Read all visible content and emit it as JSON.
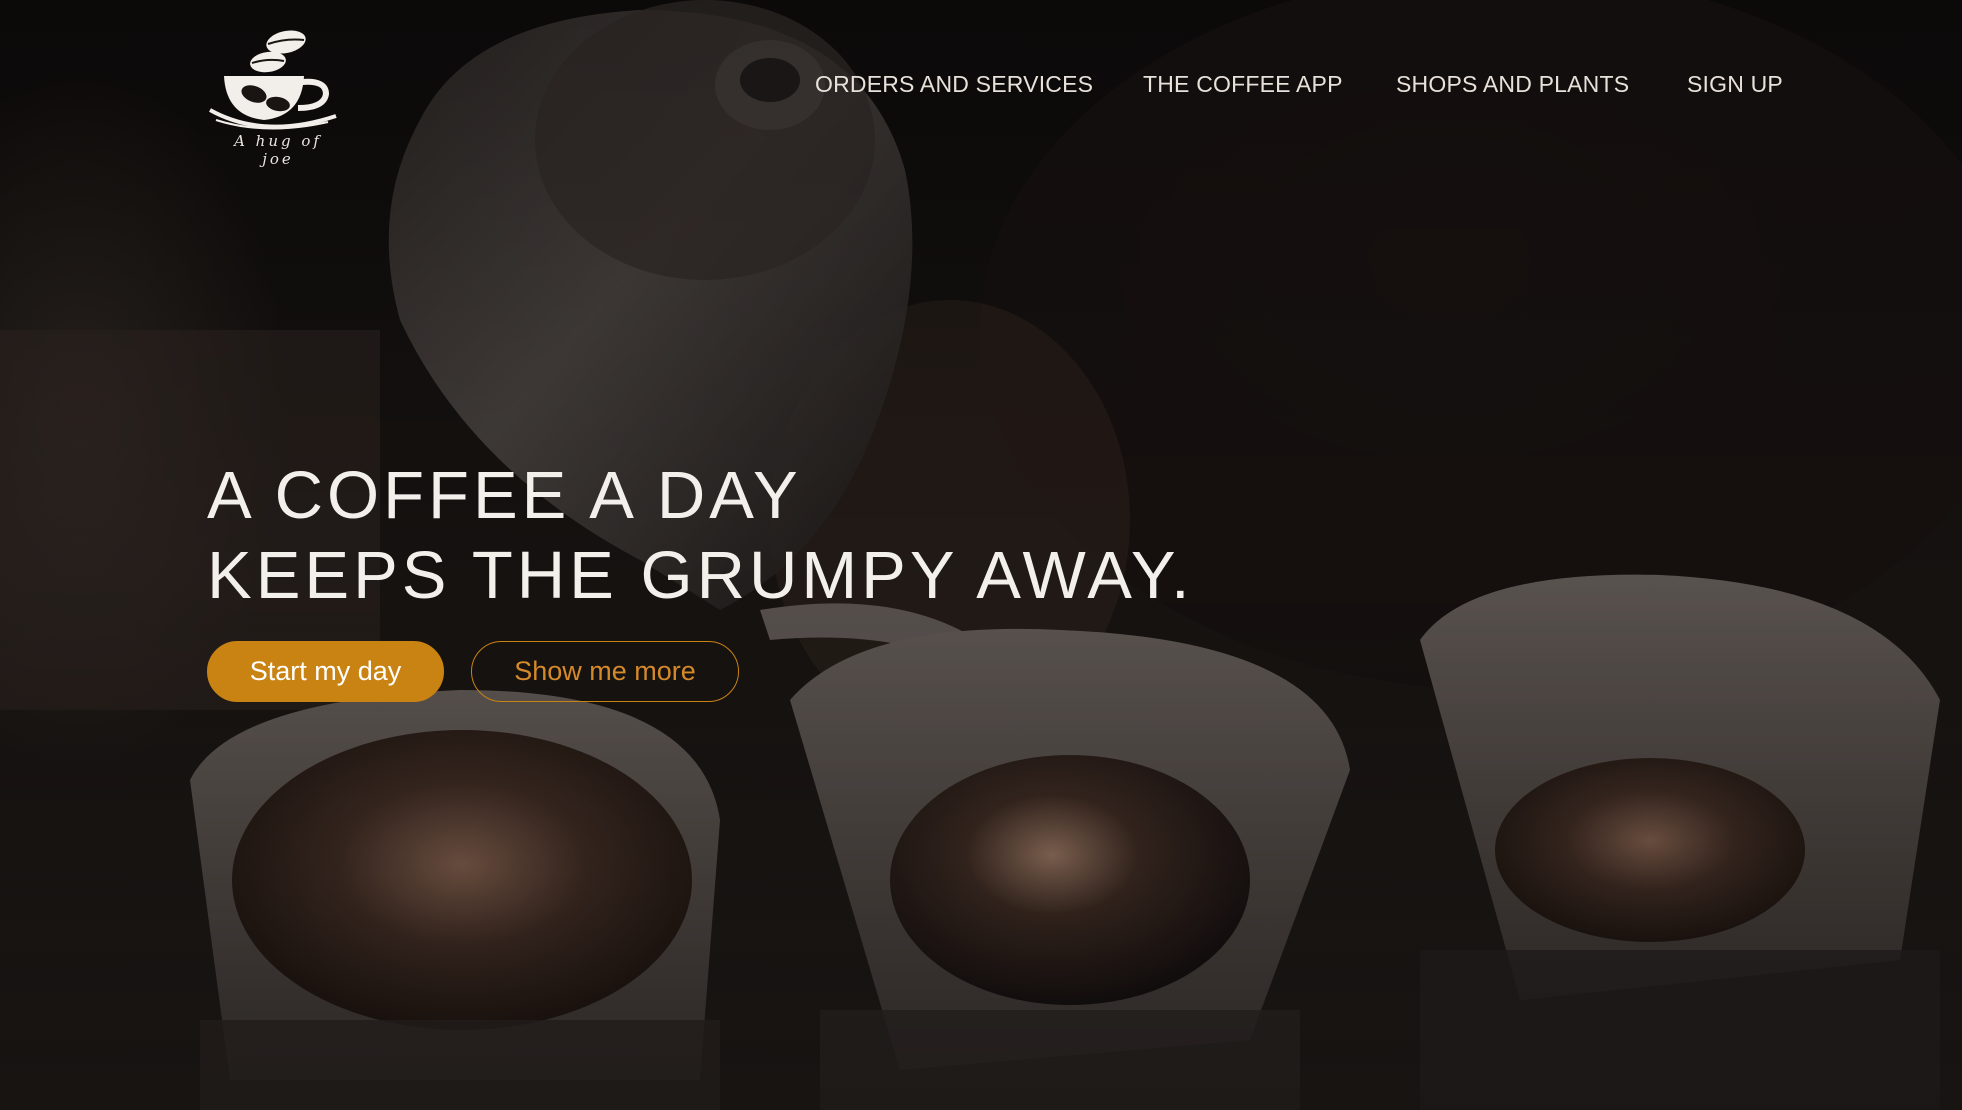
{
  "brand": {
    "tagline": "A hug of joe"
  },
  "nav": {
    "items": [
      {
        "label": "ORDERS AND SERVICES"
      },
      {
        "label": "THE COFFEE APP"
      },
      {
        "label": "SHOPS AND PLANTS"
      },
      {
        "label": "SIGN UP"
      }
    ]
  },
  "hero": {
    "headline_line1": "A COFFEE A DAY",
    "headline_line2": "KEEPS THE GRUMPY AWAY.",
    "primary_button": "Start my day",
    "secondary_button": "Show me more",
    "background_subject": "pour-over coffee brewing with gooseneck kettle"
  },
  "colors": {
    "accent": "#c98312",
    "nav_text": "#e8e1da",
    "headline_text": "#f3f0ec"
  }
}
